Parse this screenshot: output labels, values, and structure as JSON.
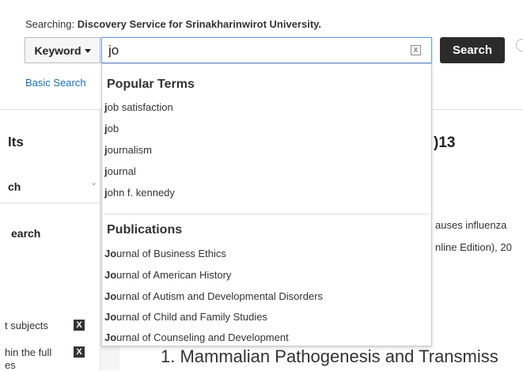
{
  "header": {
    "searching_prefix": "Searching: ",
    "searching_target": "Discovery Service for Srinakharinwirot University."
  },
  "search": {
    "field_label": "Keyword",
    "query": "jo",
    "clear_symbol": "x",
    "submit_label": "Search",
    "basic_search_label": "Basic Search"
  },
  "autocomplete": {
    "popular_heading": "Popular Terms",
    "popular_terms": [
      {
        "match": "j",
        "rest": "ob satisfaction"
      },
      {
        "match": "j",
        "rest": "ob"
      },
      {
        "match": "j",
        "rest": "ournalism"
      },
      {
        "match": "j",
        "rest": "ournal"
      },
      {
        "match": "j",
        "rest": "ohn f. kennedy"
      }
    ],
    "publications_heading": "Publications",
    "publications": [
      {
        "match": "Jo",
        "rest": "urnal of Business Ethics"
      },
      {
        "match": "Jo",
        "rest": "urnal of American History"
      },
      {
        "match": "Jo",
        "rest": "urnal of Autism and Developmental Disorders"
      },
      {
        "match": "Jo",
        "rest": "urnal of Child and Family Studies"
      },
      {
        "match": "Jo",
        "rest": "urnal of Counseling and Development"
      }
    ]
  },
  "left_panel": {
    "results_heading": "lts",
    "sort_value": "ch",
    "refine_heading": "earch",
    "facets": [
      {
        "label": "t subjects",
        "action": "X"
      },
      {
        "label": "hin the full",
        "sub": "es",
        "action": "X"
      }
    ]
  },
  "main": {
    "year_heading": ")13",
    "snippet_1": "auses influenza",
    "snippet_2": "nline Edition), 20",
    "result_title": "1. Mammalian Pathogenesis and Transmiss"
  }
}
